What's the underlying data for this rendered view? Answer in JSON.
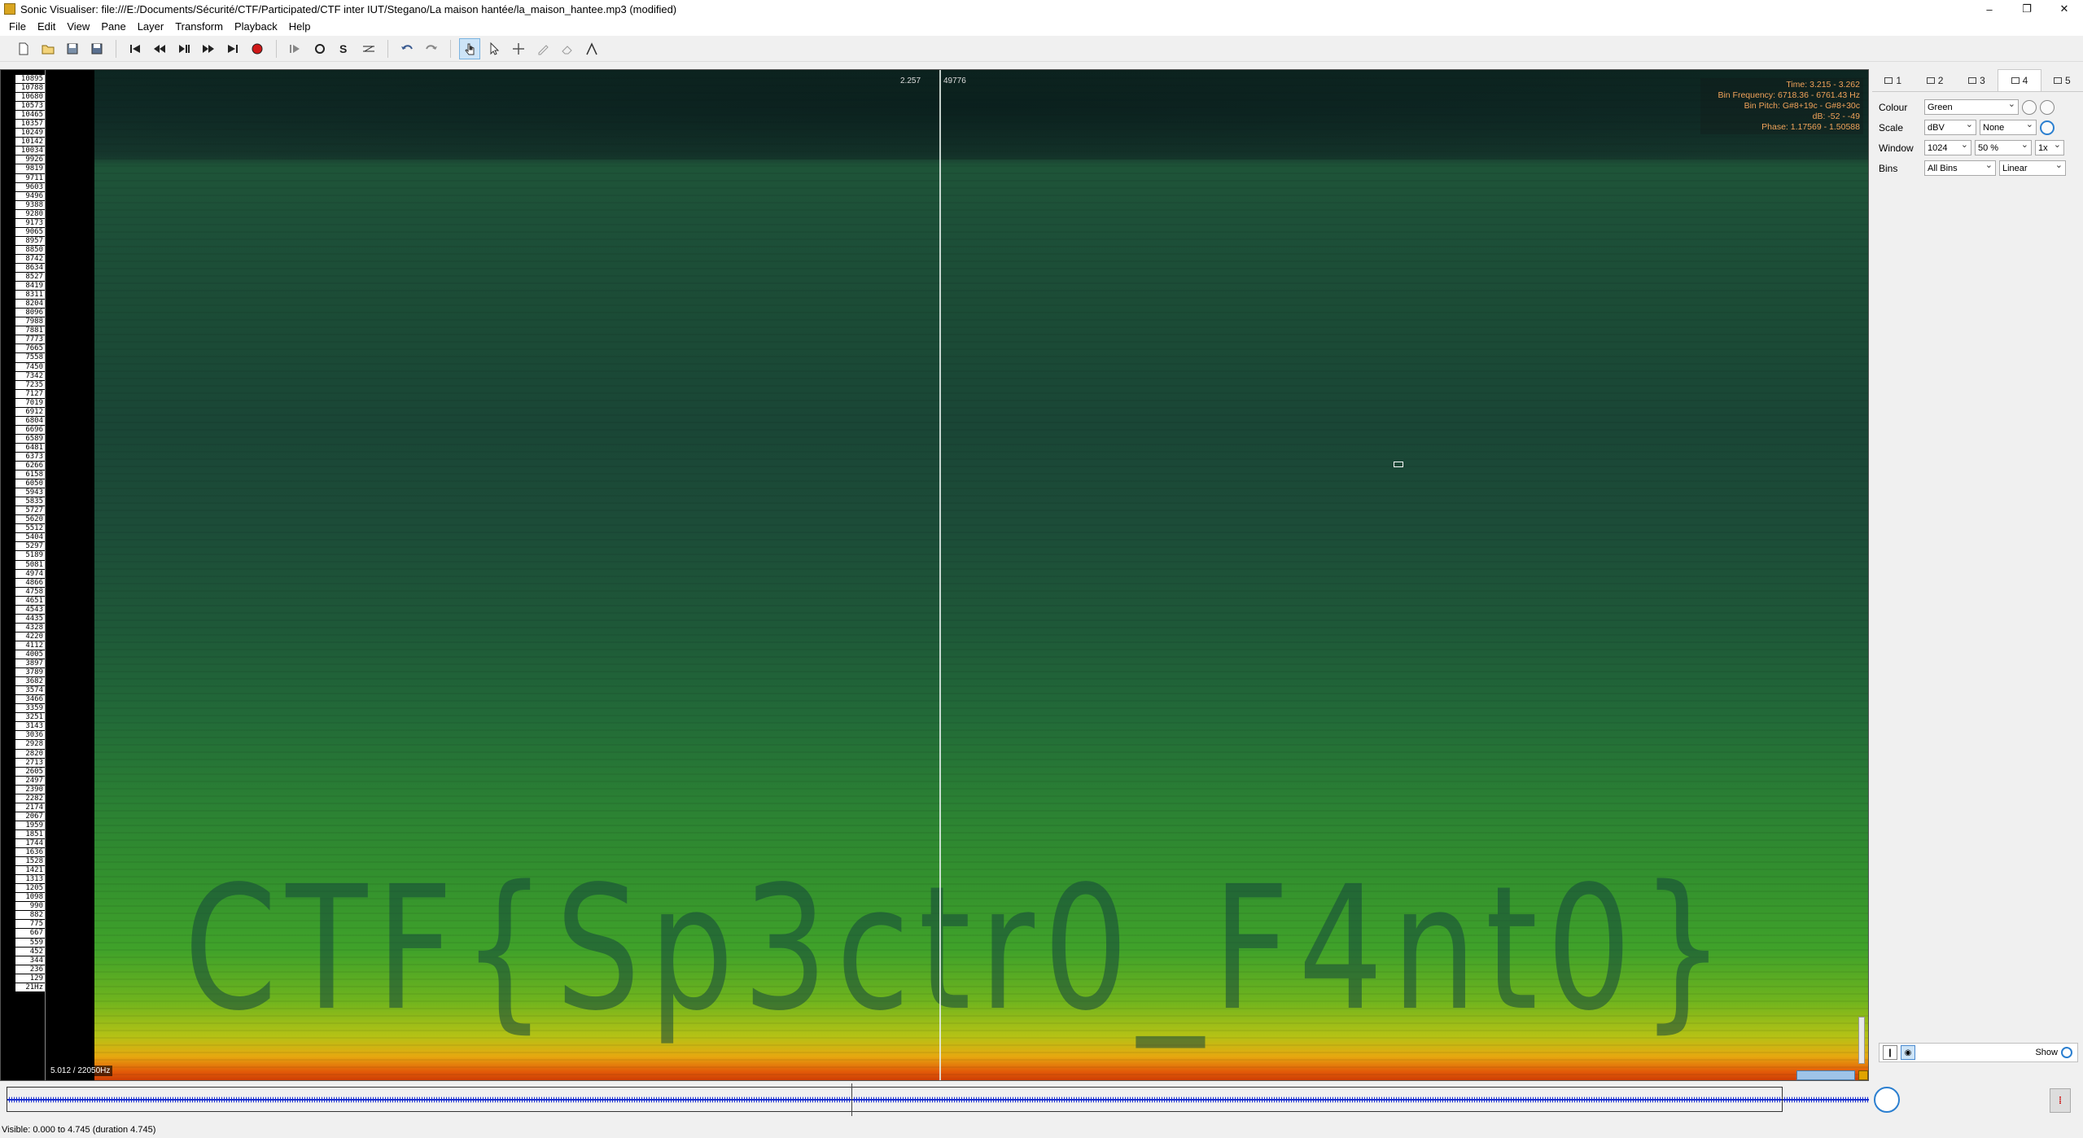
{
  "window": {
    "title": "Sonic Visualiser: file:///E:/Documents/Sécurité/CTF/Participated/CTF inter IUT/Stegano/La maison hantée/la_maison_hantee.mp3 (modified)",
    "minimize": "–",
    "restore": "❐",
    "close": "✕"
  },
  "menu": [
    "File",
    "Edit",
    "View",
    "Pane",
    "Layer",
    "Transform",
    "Playback",
    "Help"
  ],
  "toolbar": {
    "icons": [
      "new-file-icon",
      "open-file-icon",
      "save-icon",
      "save-as-icon",
      "rewind-start-icon",
      "rewind-icon",
      "play-pause-icon",
      "fast-forward-icon",
      "fast-forward-end-icon",
      "record-icon",
      "play-selection-icon",
      "loop-icon",
      "solo-icon",
      "speed-icon",
      "undo-icon",
      "redo-icon",
      "navigate-tool-icon",
      "select-tool-icon",
      "move-tool-icon",
      "draw-tool-icon",
      "erase-tool-icon",
      "measure-tool-icon"
    ],
    "active_tool": "navigate-tool-icon"
  },
  "spectrogram": {
    "freq_labels": [
      "10895",
      "10788",
      "10680",
      "10573",
      "10465",
      "10357",
      "10249",
      "10142",
      "10034",
      "9926",
      "9819",
      "9711",
      "9603",
      "9496",
      "9388",
      "9280",
      "9173",
      "9065",
      "8957",
      "8850",
      "8742",
      "8634",
      "8527",
      "8419",
      "8311",
      "8204",
      "8096",
      "7988",
      "7881",
      "7773",
      "7665",
      "7558",
      "7450",
      "7342",
      "7235",
      "7127",
      "7019",
      "6912",
      "6804",
      "6696",
      "6589",
      "6481",
      "6373",
      "6266",
      "6158",
      "6050",
      "5943",
      "5835",
      "5727",
      "5620",
      "5512",
      "5404",
      "5297",
      "5189",
      "5081",
      "4974",
      "4866",
      "4758",
      "4651",
      "4543",
      "4435",
      "4328",
      "4220",
      "4112",
      "4005",
      "3897",
      "3789",
      "3682",
      "3574",
      "3466",
      "3359",
      "3251",
      "3143",
      "3036",
      "2928",
      "2820",
      "2713",
      "2605",
      "2497",
      "2390",
      "2282",
      "2174",
      "2067",
      "1959",
      "1851",
      "1744",
      "1636",
      "1528",
      "1421",
      "1313",
      "1205",
      "1098",
      "990",
      "882",
      "775",
      "667",
      "559",
      "452",
      "344",
      "236",
      "129",
      "21Hz"
    ],
    "playhead_time": "2.257",
    "playhead_frame": "49776",
    "hidden_text": "CTF{Sp3ctr0_F4nt0}",
    "zoom_readout": "5.012 / 22050Hz",
    "info": {
      "time": "Time: 3.215 - 3.262",
      "bin_frequency": "Bin Frequency: 6718.36 - 6761.43 Hz",
      "bin_pitch": "Bin Pitch: G#8+19c - G#8+30c",
      "db": "dB: -52 - -49",
      "phase": "Phase: 1.17569 - 1.50588"
    },
    "colors": {
      "high": "#e25a08",
      "mid": "#40a22a",
      "low": "#1b4b36"
    }
  },
  "properties": {
    "tabs": [
      {
        "label": "1",
        "icon": "pane-icon"
      },
      {
        "label": "2",
        "icon": "waveform-icon"
      },
      {
        "label": "3",
        "icon": "diamond-icon"
      },
      {
        "label": "4",
        "icon": "spectrogram-icon"
      },
      {
        "label": "5",
        "icon": "layer-icon"
      }
    ],
    "active_tab": "4",
    "colour_label": "Colour",
    "colour_value": "Green",
    "scale_label": "Scale",
    "scale_value": "dBV",
    "normalize_value": "None",
    "window_label": "Window",
    "window_value": "1024",
    "overlap_value": "50 %",
    "oversample_value": "1x",
    "bins_label": "Bins",
    "bins_value": "All Bins",
    "bins_scale_value": "Linear",
    "show_label": "Show"
  },
  "status": {
    "visible": "Visible: 0.000 to 4.745 (duration 4.745)"
  }
}
